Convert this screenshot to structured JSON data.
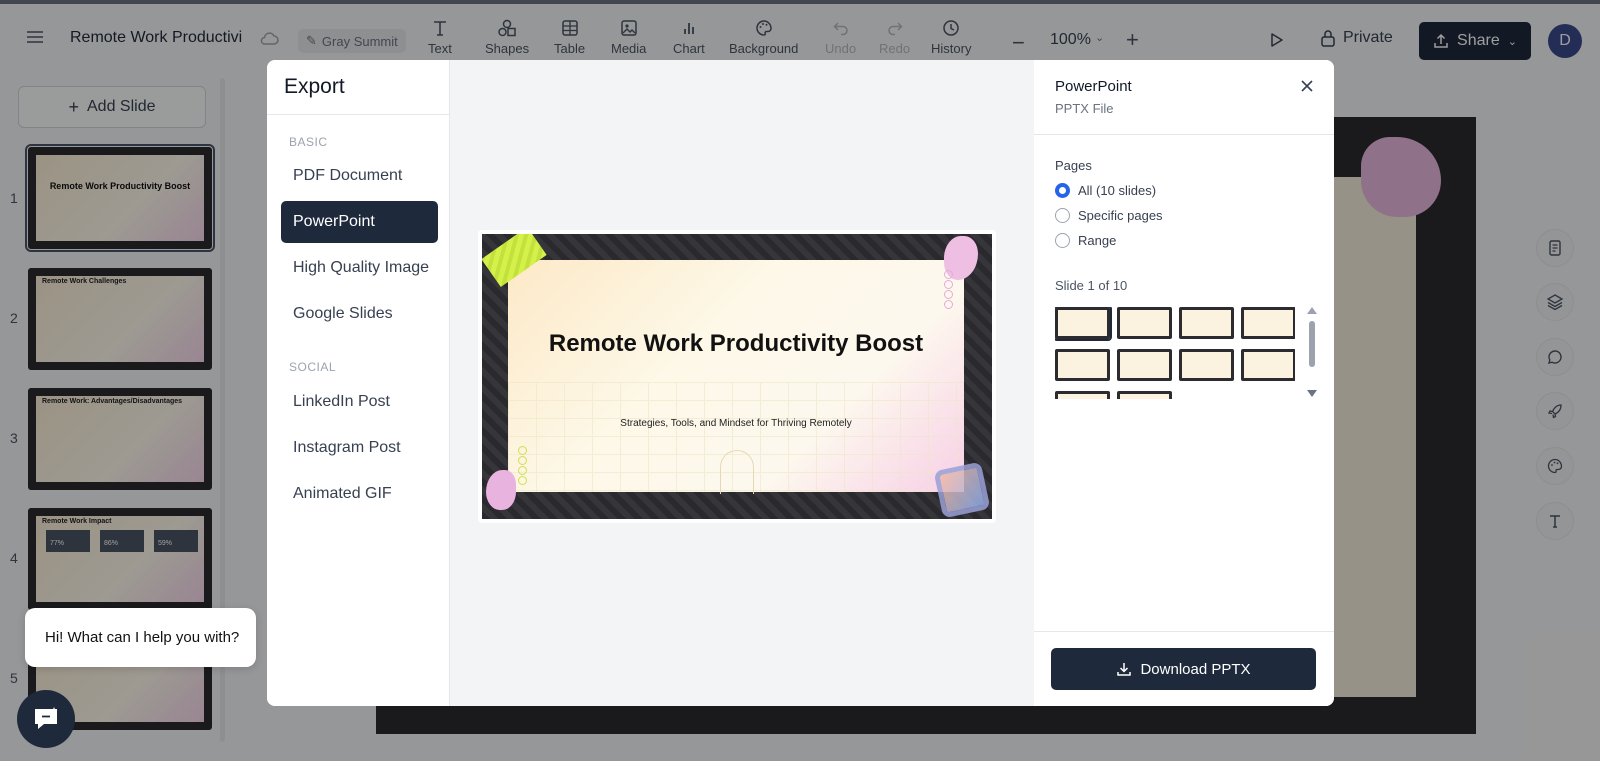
{
  "app": {
    "doc_title": "Remote Work Productivi",
    "theme_name": "Gray Summit"
  },
  "toolbar": {
    "tools": [
      {
        "label": "Text",
        "icon": "text-icon"
      },
      {
        "label": "Shapes",
        "icon": "shapes-icon"
      },
      {
        "label": "Table",
        "icon": "table-icon"
      },
      {
        "label": "Media",
        "icon": "media-icon"
      },
      {
        "label": "Chart",
        "icon": "chart-icon"
      },
      {
        "label": "Background",
        "icon": "palette-icon"
      },
      {
        "label": "Undo",
        "icon": "undo-icon",
        "disabled": true
      },
      {
        "label": "Redo",
        "icon": "redo-icon",
        "disabled": true
      },
      {
        "label": "History",
        "icon": "clock-icon"
      }
    ],
    "zoom": "100%",
    "privacy_label": "Private",
    "share_label": "Share",
    "avatar_initial": "D"
  },
  "left_panel": {
    "add_slide_label": "Add Slide",
    "slides": [
      {
        "number": "1",
        "title": "Remote Work Productivity Boost",
        "subtitle": "Strategies, Tools, and Mindset for Thriving Remotely"
      },
      {
        "number": "2",
        "title": "Remote Work Challenges"
      },
      {
        "number": "3",
        "title": "Remote Work: Advantages/Disadvantages"
      },
      {
        "number": "4",
        "title": "Remote Work Impact",
        "stats": [
          "77%",
          "86%",
          "59%"
        ]
      },
      {
        "number": "5",
        "title": ""
      }
    ]
  },
  "export_modal": {
    "title": "Export",
    "sections": [
      {
        "label": "BASIC",
        "options": [
          "PDF Document",
          "PowerPoint",
          "High Quality Image",
          "Google Slides"
        ]
      },
      {
        "label": "SOCIAL",
        "options": [
          "LinkedIn Post",
          "Instagram Post",
          "Animated GIF"
        ]
      }
    ],
    "selected_option": "PowerPoint",
    "preview": {
      "title": "Remote Work Productivity Boost",
      "subtitle": "Strategies, Tools, and Mindset for Thriving Remotely"
    },
    "settings": {
      "format_title": "PowerPoint",
      "format_subtitle": "PPTX File",
      "pages_label": "Pages",
      "page_options": [
        "All (10 slides)",
        "Specific pages",
        "Range"
      ],
      "selected_page_option": "All (10 slides)",
      "slide_counter": "Slide 1 of 10",
      "download_label": "Download PPTX"
    }
  },
  "chat": {
    "greeting": "Hi! What can I help you with?"
  },
  "colors": {
    "accent_dark": "#1e293b",
    "radio_selected": "#2563eb"
  }
}
